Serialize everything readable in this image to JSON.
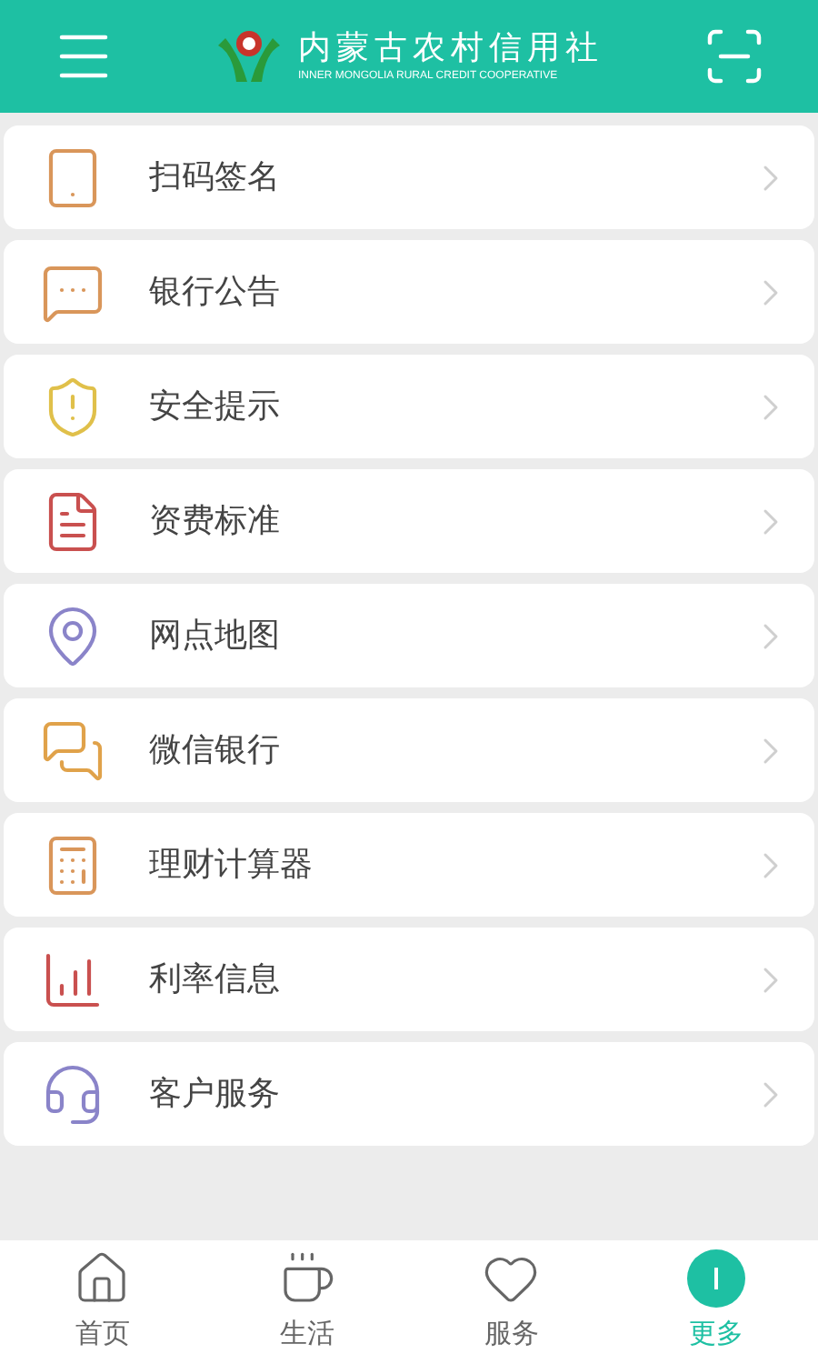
{
  "header": {
    "title": "内蒙古农村信用社",
    "subtitle": "INNER MONGOLIA RURAL CREDIT COOPERATIVE"
  },
  "menu_items": [
    {
      "label": "扫码签名",
      "kind": "tablet",
      "color": "#d9965a"
    },
    {
      "label": "银行公告",
      "kind": "notice",
      "color": "#d9965a"
    },
    {
      "label": "安全提示",
      "kind": "shield",
      "color": "#e0c04a"
    },
    {
      "label": "资费标准",
      "kind": "fee",
      "color": "#c9504f"
    },
    {
      "label": "网点地图",
      "kind": "map",
      "color": "#8a84c9"
    },
    {
      "label": "微信银行",
      "kind": "chat",
      "color": "#e0a24a"
    },
    {
      "label": "理财计算器",
      "kind": "calculator",
      "color": "#d9965a"
    },
    {
      "label": "利率信息",
      "kind": "chart",
      "color": "#c9504f"
    },
    {
      "label": "客户服务",
      "kind": "service",
      "color": "#8a84c9"
    }
  ],
  "tab_bar": [
    {
      "label": "首页",
      "kind": "home",
      "selected": false
    },
    {
      "label": "生活",
      "kind": "life",
      "selected": false
    },
    {
      "label": "服务",
      "kind": "service",
      "selected": false
    },
    {
      "label": "更多",
      "kind": "more",
      "selected": true
    }
  ]
}
